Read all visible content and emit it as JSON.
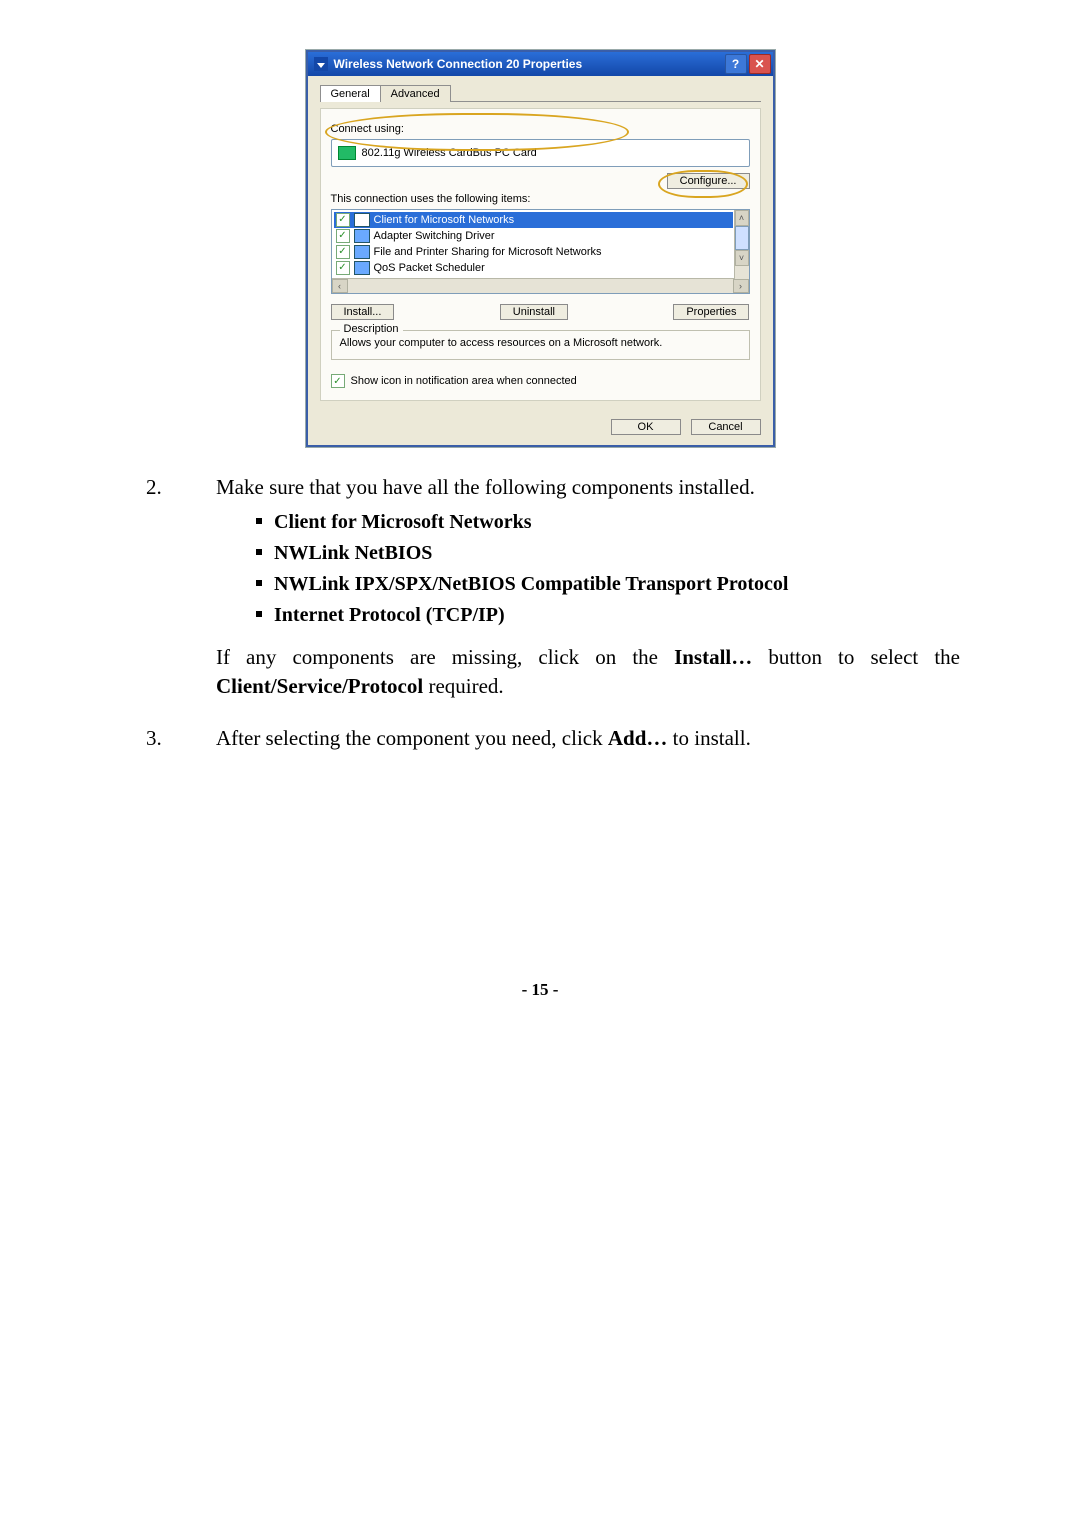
{
  "dialog": {
    "title": "Wireless Network Connection 20 Properties",
    "tabs": [
      "General",
      "Advanced"
    ],
    "connect_label": "Connect using:",
    "adapter": "802.11g Wireless CardBus PC Card",
    "configure": "Configure...",
    "uses_label": "This connection uses the following items:",
    "items": [
      "Client for Microsoft Networks",
      "Adapter Switching Driver",
      "File and Printer Sharing for Microsoft Networks",
      "QoS Packet Scheduler"
    ],
    "install": "Install...",
    "uninstall": "Uninstall",
    "properties": "Properties",
    "desc_legend": "Description",
    "desc_text": "Allows your computer to access resources on a Microsoft network.",
    "show_icon": "Show icon in notification area when connected",
    "ok": "OK",
    "cancel": "Cancel"
  },
  "doc": {
    "step2_num": "2.",
    "step2_text": "Make sure that you have all the following components installed.",
    "bullets": [
      "Client for Microsoft Networks",
      "NWLink NetBIOS",
      "NWLink IPX/SPX/NetBIOS Compatible Transport Protocol",
      "Internet Protocol (TCP/IP)"
    ],
    "step2_p1a": "If any components are missing, click on the ",
    "step2_p1b": "Install…",
    "step2_p1c": " button to select the ",
    "step2_p1d": "Client/Service/Protocol",
    "step2_p1e": " required.",
    "step3_num": "3.",
    "step3_a": "After selecting the component you need, click ",
    "step3_b": "Add…",
    "step3_c": " to install.",
    "page": "- 15 -"
  }
}
